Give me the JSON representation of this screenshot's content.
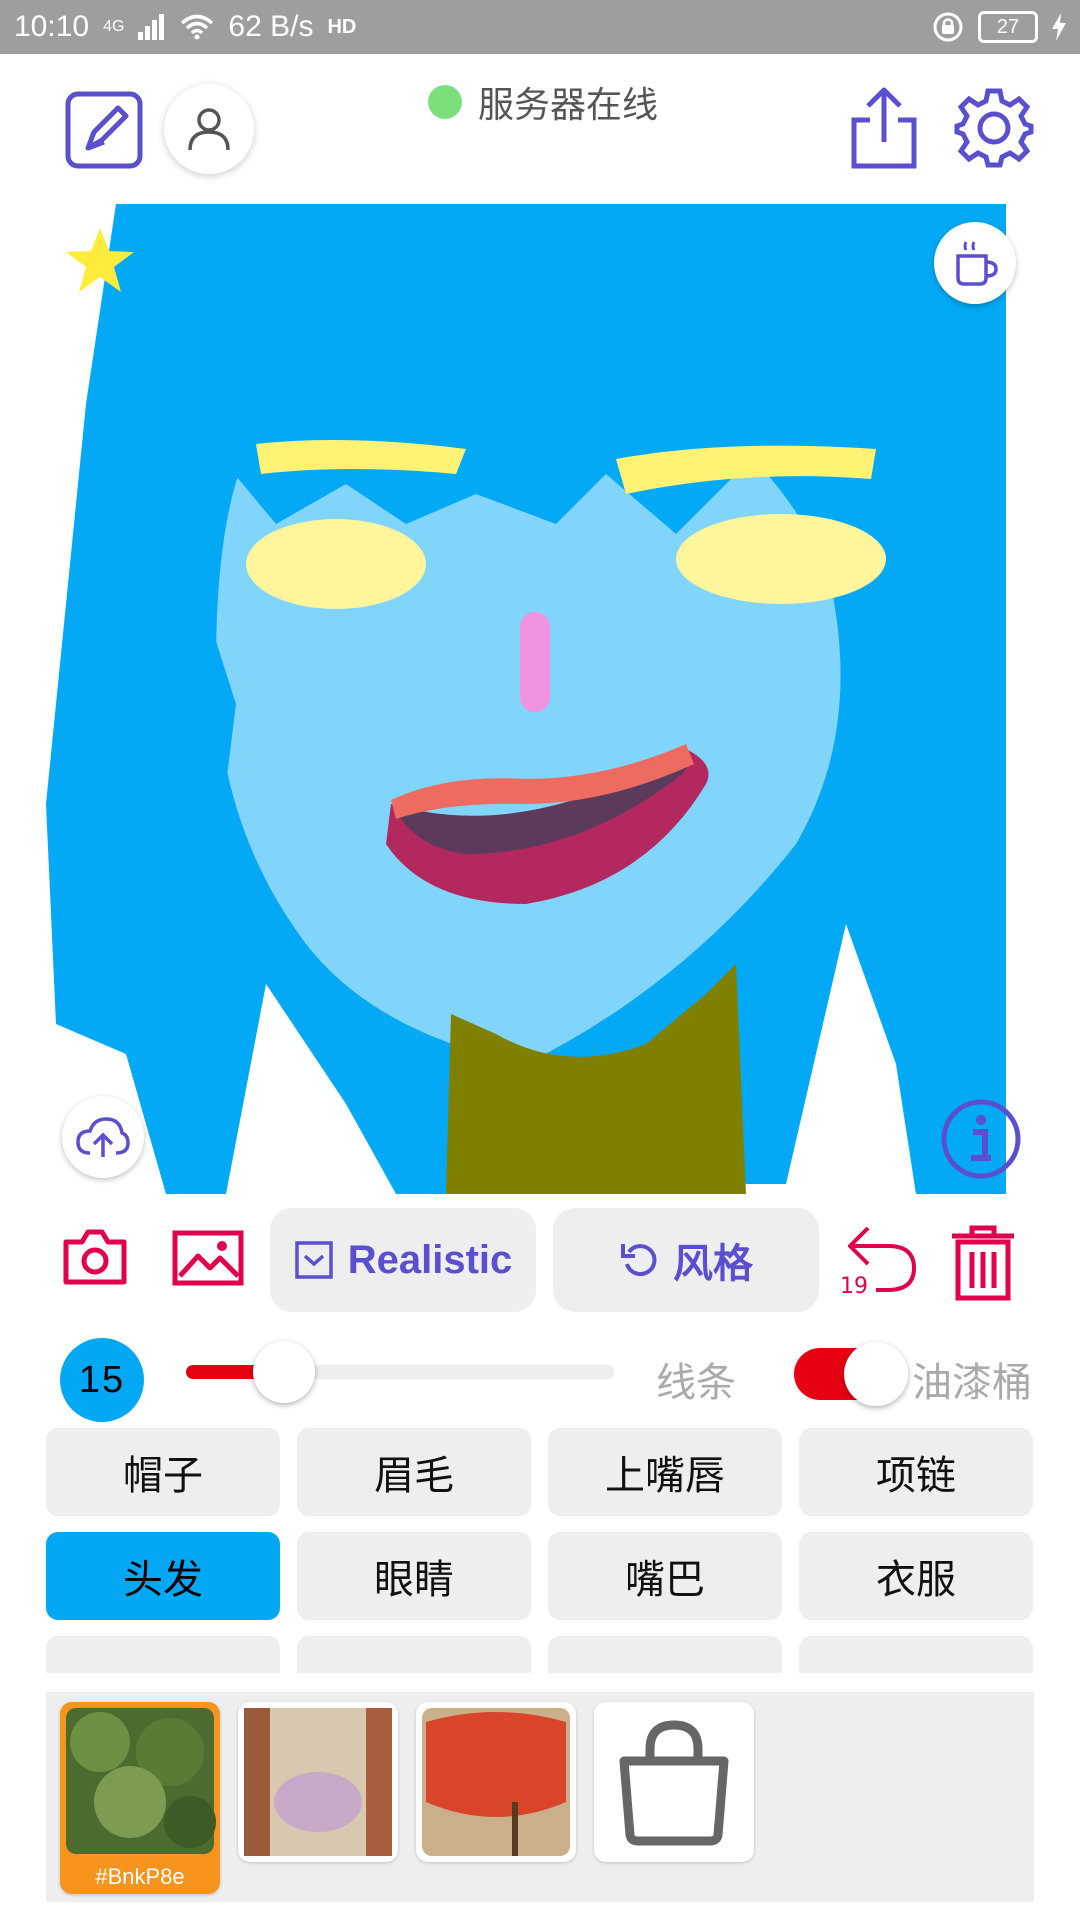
{
  "statusbar": {
    "time": "10:10",
    "network": "4G",
    "speed": "62 B/s",
    "hd": "HD",
    "battery": "27"
  },
  "header": {
    "server_status": "服务器在线",
    "status_color": "#7be07b"
  },
  "icons": {
    "edit": "pencil-square-icon",
    "user": "user-icon",
    "share": "share-icon",
    "settings": "gear-icon",
    "coffee": "coffee-icon",
    "star": "star-icon",
    "upload": "cloud-upload-icon",
    "info": "info-icon"
  },
  "tools": {
    "mode_label": "Realistic",
    "style_label": "风格",
    "undo_count": "19"
  },
  "brush": {
    "size": "15",
    "size_fraction": 0.23,
    "line_label": "线条",
    "bucket_label": "油漆桶",
    "bucket_on": true
  },
  "parts": {
    "row1": [
      "帽子",
      "眉毛",
      "上嘴唇",
      "项链"
    ],
    "row2": [
      "头发",
      "眼睛",
      "嘴巴",
      "衣服"
    ],
    "row3": [
      "",
      "",
      "",
      ""
    ],
    "selected": "头发"
  },
  "gallery": {
    "items": [
      {
        "tag": "#BnkP8e",
        "selected": true
      },
      {
        "tag": "",
        "selected": false
      },
      {
        "tag": "",
        "selected": false
      }
    ]
  },
  "colors": {
    "accent": "#5a4fcf",
    "pink": "#e0004c",
    "blue": "#02a8f3",
    "red": "#e60012"
  }
}
